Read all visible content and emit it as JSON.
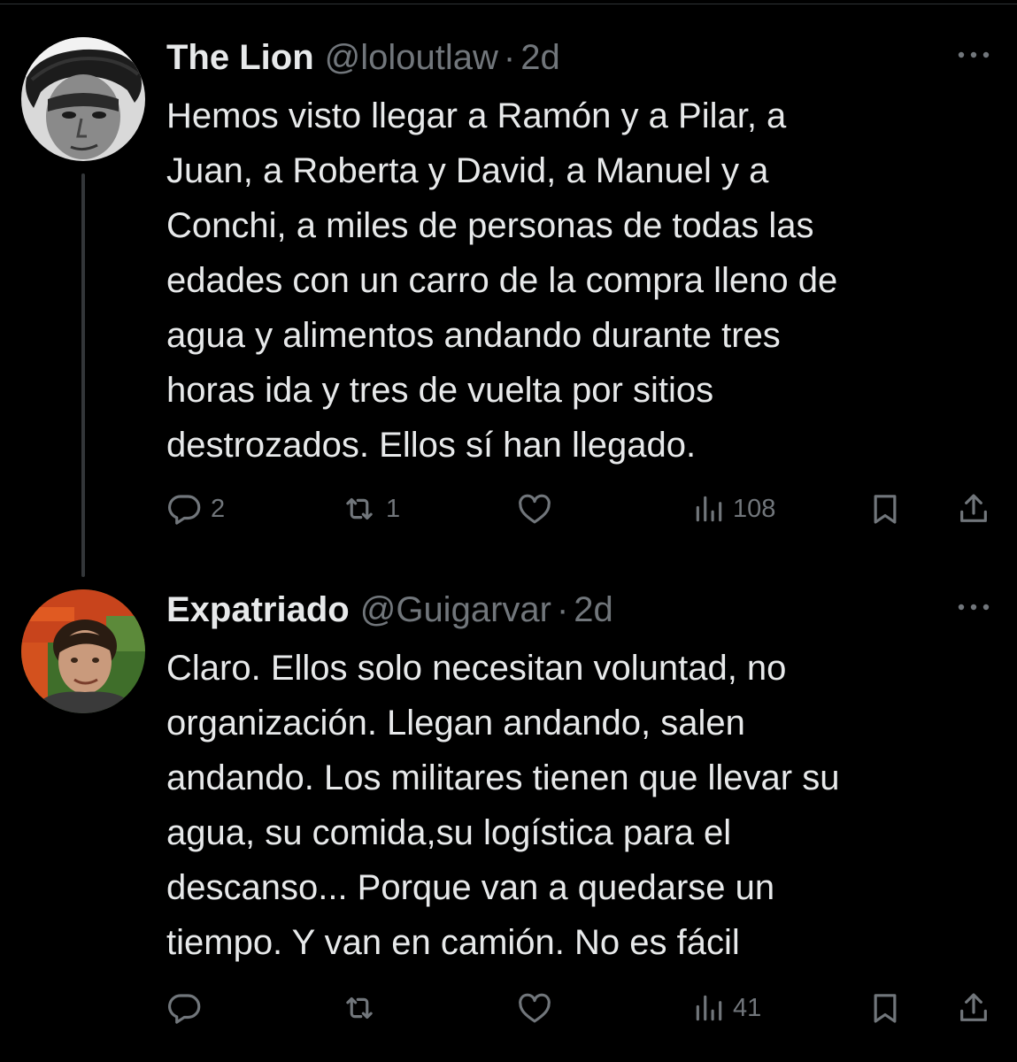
{
  "tweets": [
    {
      "name": "The Lion",
      "handle": "@loloutlaw",
      "separator": "·",
      "time": "2d",
      "lines": [
        "Hemos visto llegar a Ramón y a Pilar, a",
        "Juan, a Roberta y David, a Manuel y a",
        "Conchi, a miles de personas de todas las",
        "edades con un carro de la compra lleno de",
        "agua y alimentos andando durante tres",
        "horas ida y tres de vuelta por sitios",
        "destrozados. Ellos sí han llegado."
      ],
      "stats": {
        "replies": "2",
        "retweets": "1",
        "likes": "",
        "views": "108"
      }
    },
    {
      "name": "Expatriado",
      "handle": "@Guigarvar",
      "separator": "·",
      "time": "2d",
      "lines": [
        "Claro. Ellos solo necesitan voluntad, no",
        "organización. Llegan andando, salen",
        "andando. Los militares tienen que llevar su",
        "agua, su comida,su logística para el",
        "descanso... Porque van a quedarse un",
        "tiempo. Y van en camión. No es fácil"
      ],
      "stats": {
        "replies": "",
        "retweets": "",
        "likes": "",
        "views": "41"
      }
    }
  ],
  "icons": {
    "more": "more-horizontal-icon",
    "reply": "reply-icon",
    "retweet": "retweet-icon",
    "like": "heart-icon",
    "views": "views-icon",
    "bookmark": "bookmark-icon",
    "share": "share-icon"
  },
  "colors": {
    "background": "#000000",
    "primary_text": "#e7e9ea",
    "secondary_text": "#71767b",
    "thread_line": "#333639"
  }
}
